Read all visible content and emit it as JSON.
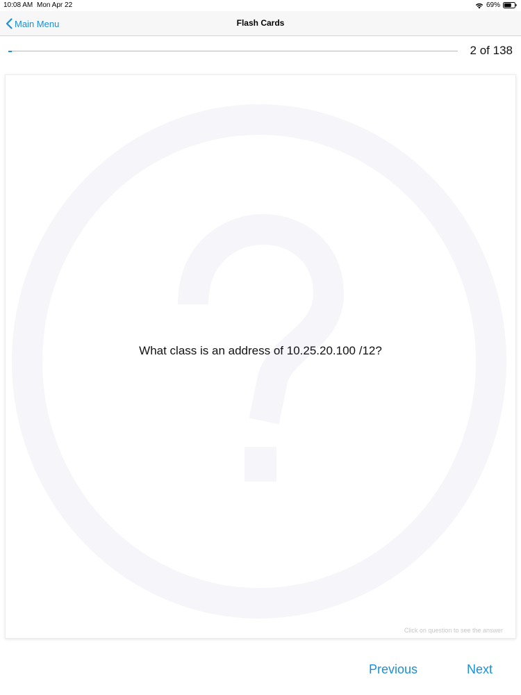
{
  "status_bar": {
    "time": "10:08 AM",
    "date": "Mon Apr 22",
    "battery_percent": "69%",
    "battery_level": 0.69,
    "icons": [
      "wifi-icon",
      "battery-icon"
    ]
  },
  "nav": {
    "back_label": "Main Menu",
    "back_icon": "chevron-left-icon",
    "title": "Flash Cards"
  },
  "progress": {
    "label": "2 of 138",
    "current": 2,
    "total": 138
  },
  "card": {
    "question": "What class is an address of 10.25.20.100 /12?",
    "hint": "Click on question to see the answer",
    "watermark_icon": "question-mark-icon"
  },
  "buttons": {
    "previous_label": "Previous",
    "next_label": "Next"
  },
  "colors": {
    "accent": "#1a8fd8",
    "nav_background": "#f7f7f8",
    "watermark": "#f6f5f9"
  }
}
